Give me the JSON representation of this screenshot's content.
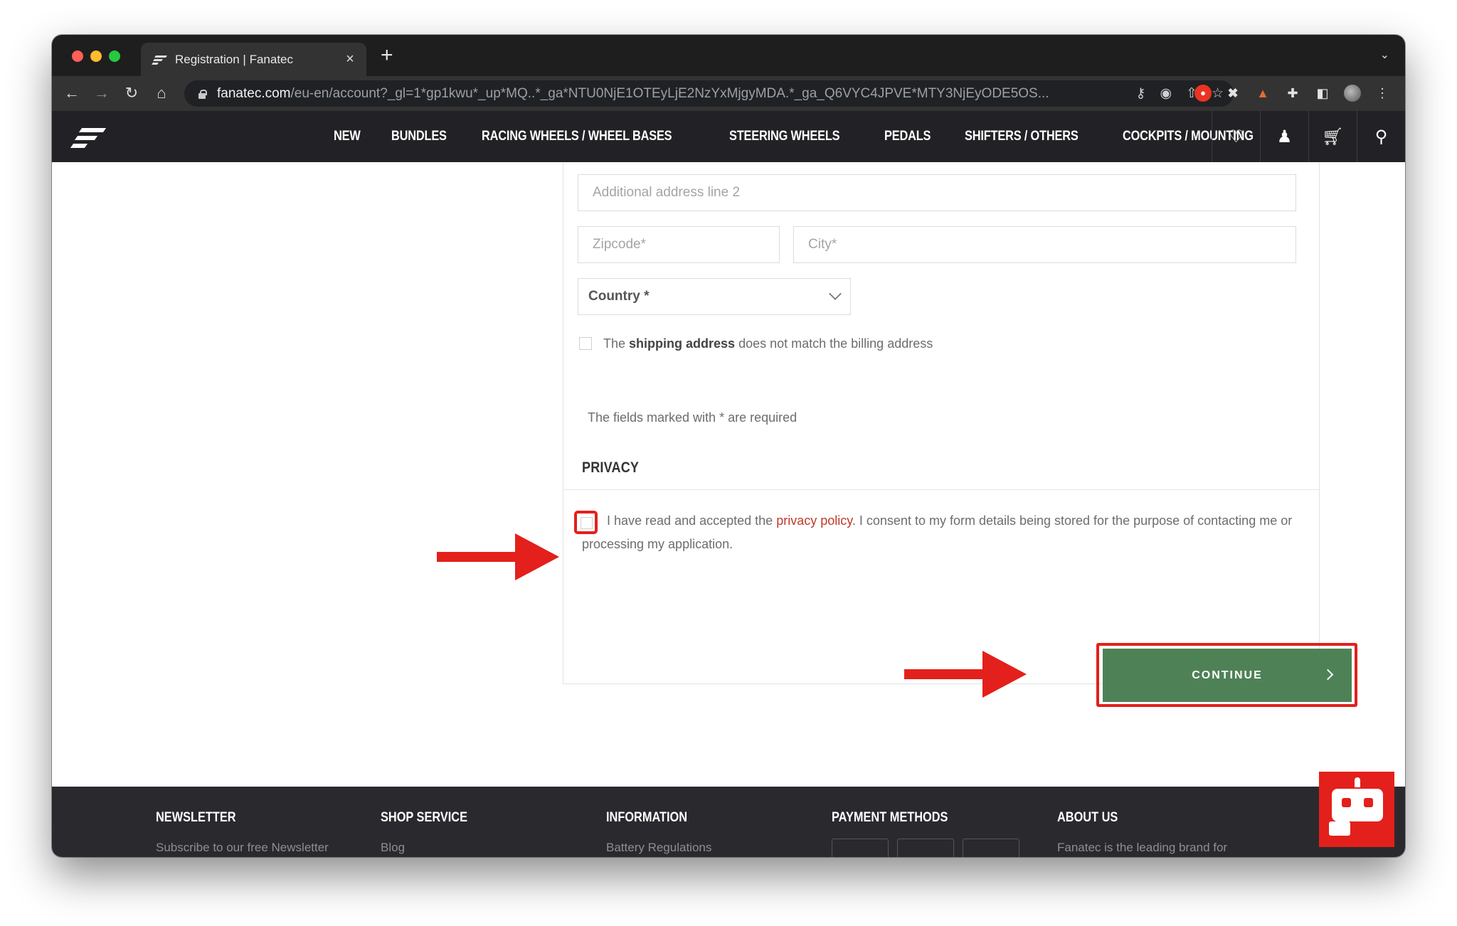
{
  "browser": {
    "tab_title": "Registration | Fanatec",
    "new_tab": "+",
    "tab_close": "×",
    "url_host": "fanatec.com",
    "url_path": "/eu-en/account?_gl=1*gp1kwu*_up*MQ..*_ga*NTU0NjE1OTEyLjE2NzYxMjgyMDA.*_ga_Q6VYC4JPVE*MTY3NjEyODE5OS..."
  },
  "site": {
    "nav": [
      "NEW",
      "BUNDLES",
      "RACING WHEELS / WHEEL BASES",
      "STEERING WHEELS",
      "PEDALS",
      "SHIFTERS / OTHERS",
      "COCKPITS / MOUNTING"
    ]
  },
  "form": {
    "address2_placeholder": "Additional address line 2",
    "zipcode_placeholder": "Zipcode*",
    "city_placeholder": "City*",
    "country_label": "Country *",
    "shipping_prefix": "The ",
    "shipping_bold": "shipping address",
    "shipping_suffix": " does not match the billing address",
    "required_note": "The fields marked with * are required",
    "privacy_title": "PRIVACY",
    "privacy_prefix": "I have read and accepted the ",
    "privacy_link": "privacy policy",
    "privacy_suffix": ". I consent to my form details being stored for the purpose of contacting me or processing my application.",
    "continue_label": "CONTINUE"
  },
  "footer": {
    "columns": [
      {
        "title": "NEWSLETTER",
        "sub": "Subscribe to our free Newsletter"
      },
      {
        "title": "SHOP SERVICE",
        "sub": "Blog"
      },
      {
        "title": "INFORMATION",
        "sub": "Battery Regulations"
      },
      {
        "title": "PAYMENT METHODS",
        "sub": ""
      },
      {
        "title": "ABOUT US",
        "sub": "Fanatec is the leading brand for"
      }
    ]
  },
  "colors": {
    "accent_red": "#e3201b",
    "continue_green": "#4e8256",
    "header_bg": "#222226"
  }
}
